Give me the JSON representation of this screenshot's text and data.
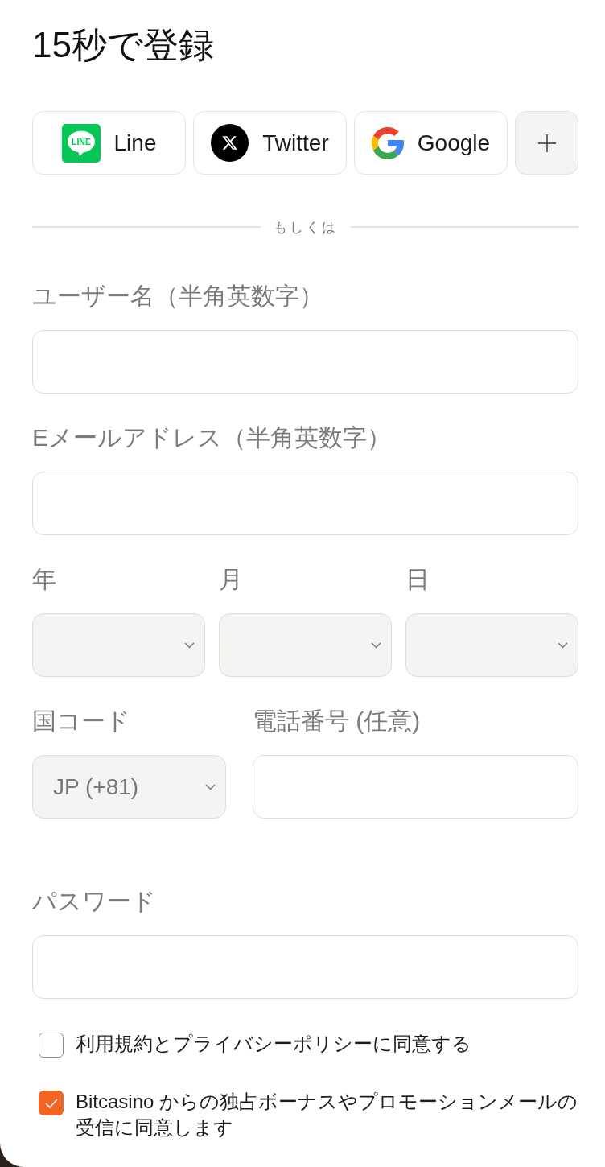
{
  "title": "15秒で登録",
  "social_buttons": [
    {
      "kind": "line",
      "label": "Line",
      "icon_text": "LINE"
    },
    {
      "kind": "twitter",
      "label": "Twitter"
    },
    {
      "kind": "google",
      "label": "Google"
    },
    {
      "kind": "more"
    }
  ],
  "divider_text": "もしくは",
  "form_rows": [
    {
      "kind": "single",
      "fields": [
        {
          "kind": "input",
          "label": "ユーザー名（半角英数字）"
        }
      ]
    },
    {
      "kind": "single",
      "fields": [
        {
          "kind": "input",
          "label": "Eメールアドレス（半角英数字）"
        }
      ]
    },
    {
      "kind": "date",
      "fields": [
        {
          "kind": "select",
          "label": "年"
        },
        {
          "kind": "select",
          "label": "月"
        },
        {
          "kind": "select",
          "label": "日"
        }
      ]
    },
    {
      "kind": "phone",
      "fields": [
        {
          "kind": "select",
          "label": "国コード",
          "value": "JP (+81)"
        },
        {
          "kind": "input",
          "label": "電話番号 (任意)"
        }
      ]
    },
    {
      "kind": "single",
      "fields": [
        {
          "kind": "input",
          "label": "パスワード"
        }
      ]
    }
  ],
  "consents": [
    {
      "text": "利用規約とプライバシーポリシーに同意する",
      "checked": false
    },
    {
      "text": "Bitcasino からの独占ボーナスやプロモーションメールの受信に同意します",
      "checked": true
    }
  ]
}
